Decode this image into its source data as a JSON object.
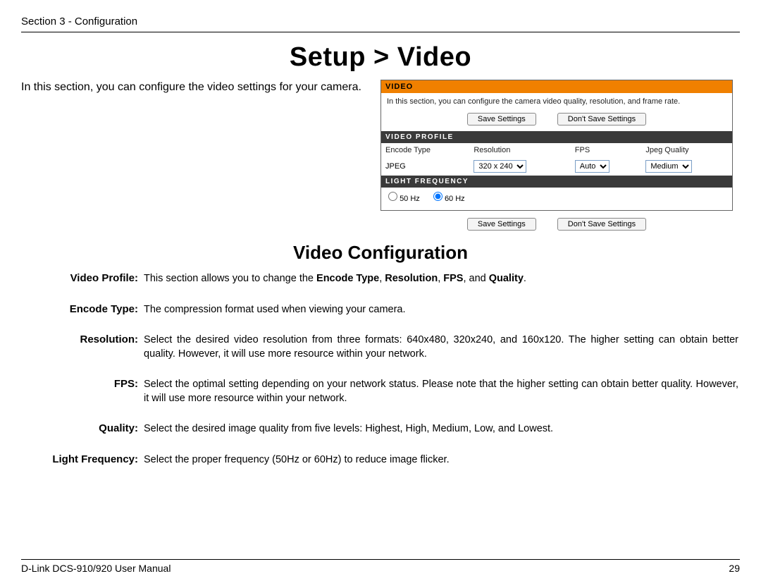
{
  "header": {
    "section_label": "Section 3 - Configuration"
  },
  "title": "Setup > Video",
  "intro": "In this section, you can configure the video settings for your camera.",
  "ui": {
    "video_header": "VIDEO",
    "video_desc": "In this section, you can configure the camera video quality, resolution, and frame rate.",
    "save_btn": "Save Settings",
    "dont_save_btn": "Don't Save Settings",
    "profile_header": "VIDEO PROFILE",
    "cols": {
      "encode": "Encode Type",
      "resolution": "Resolution",
      "fps": "FPS",
      "quality": "Jpeg Quality"
    },
    "row": {
      "encode": "JPEG",
      "resolution": "320 x 240",
      "fps": "Auto",
      "quality": "Medium"
    },
    "light_header": "LIGHT FREQUENCY",
    "freq50": "50 Hz",
    "freq60": "60 Hz"
  },
  "subtitle": "Video Configuration",
  "defs": {
    "profile_label": "Video Profile:",
    "profile_body_pre": "This section allows you to change the ",
    "profile_b1": "Encode Type",
    "profile_b2": "Resolution",
    "profile_b3": "FPS",
    "profile_b4": "Quality",
    "encode_label": "Encode Type:",
    "encode_body": "The compression format used when viewing your camera.",
    "resolution_label": "Resolution:",
    "resolution_body": "Select the desired video resolution from three formats: 640x480, 320x240, and 160x120. The higher setting can obtain better quality. However, it will use more resource within your network.",
    "fps_label": "FPS:",
    "fps_body": "Select the optimal setting depending on your network status. Please note that the higher setting can obtain better quality. However, it will use more resource within your network.",
    "quality_label": "Quality:",
    "quality_body": "Select the desired image quality from five levels: Highest, High, Medium, Low, and Lowest.",
    "light_label": "Light Frequency:",
    "light_body": "Select the proper frequency (50Hz or 60Hz) to reduce image flicker."
  },
  "footer": {
    "manual": "D-Link DCS-910/920 User Manual",
    "page": "29"
  }
}
